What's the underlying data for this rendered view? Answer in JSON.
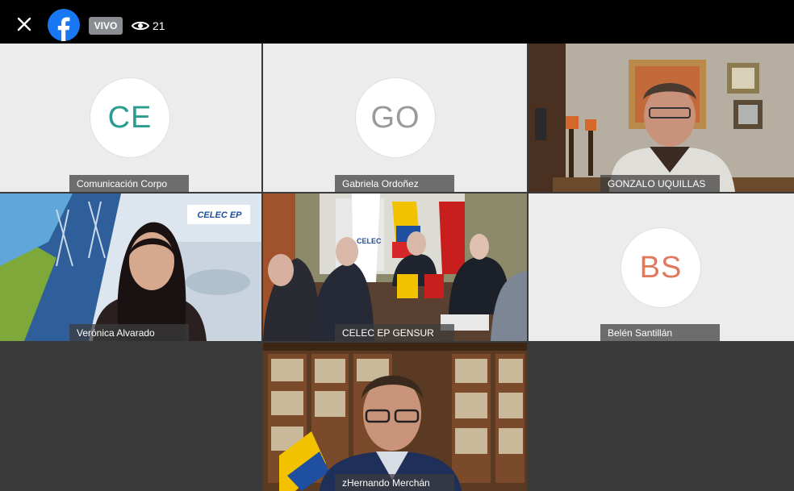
{
  "topbar": {
    "live_label": "VIVO",
    "viewer_count": "21"
  },
  "tiles": {
    "t1": {
      "initials": "CE",
      "initials_color": "#2a9d8f",
      "name": "Comunicación Corpo"
    },
    "t2": {
      "initials": "GO",
      "initials_color": "#9a9a9a",
      "name": "Gabriela Ordoñez"
    },
    "t3": {
      "name": "GONZALO UQUILLAS"
    },
    "t4": {
      "name": "Verónica Alvarado",
      "banner_text": "CELEC EP"
    },
    "t5": {
      "name": "CELEC EP GENSUR",
      "banner_text": "CELEC"
    },
    "t6": {
      "initials": "BS",
      "initials_color": "#e07a5f",
      "name": "Belén Santillán"
    },
    "t7": {
      "name": "zHernando Merchán"
    }
  },
  "colors": {
    "facebook_blue": "#1877f2",
    "live_badge": "#8a8d91"
  }
}
